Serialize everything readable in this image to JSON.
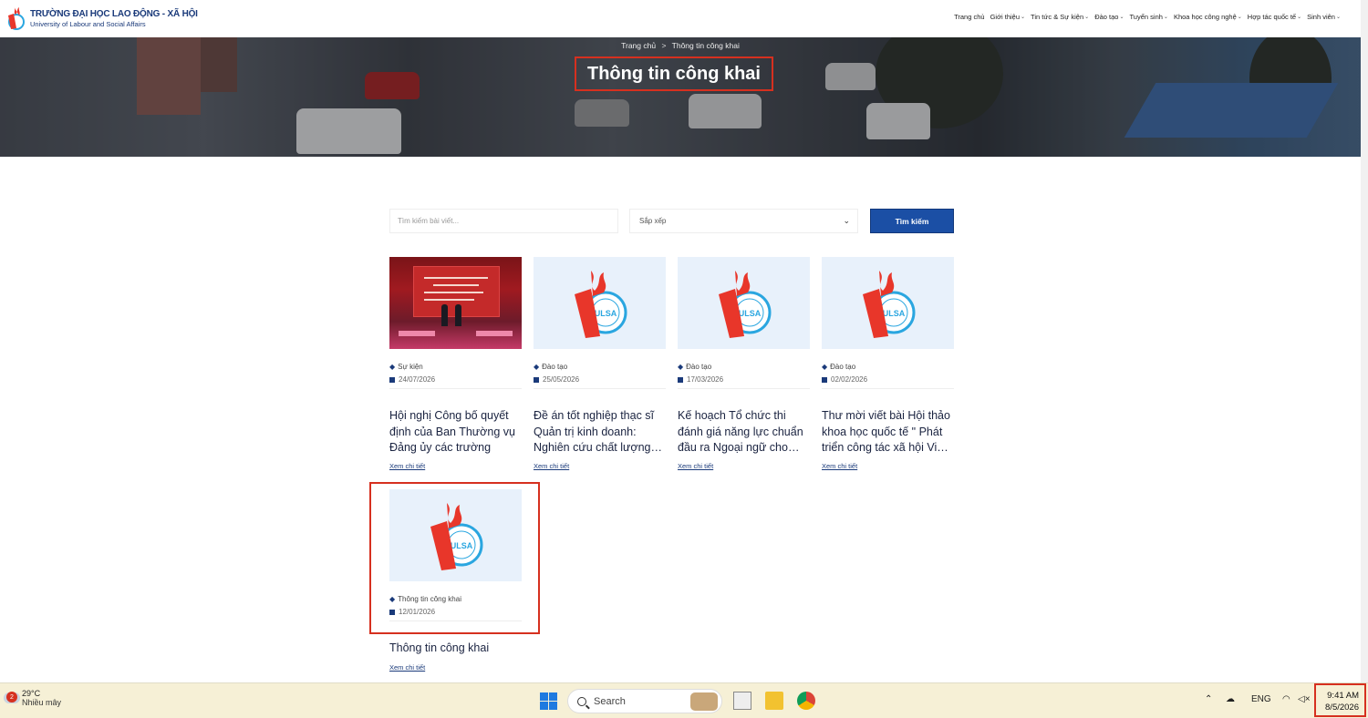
{
  "header": {
    "logo_title": "TRƯỜNG ĐẠI HỌC LAO ĐỘNG - XÃ HỘI",
    "logo_subtitle": "University of Labour and Social Affairs",
    "nav": [
      {
        "label": "Trang chủ",
        "dropdown": false
      },
      {
        "label": "Giới thiệu",
        "dropdown": true
      },
      {
        "label": "Tin tức & Sự kiện",
        "dropdown": true
      },
      {
        "label": "Đào tạo",
        "dropdown": true
      },
      {
        "label": "Tuyển sinh",
        "dropdown": true
      },
      {
        "label": "Khoa học công nghệ",
        "dropdown": true
      },
      {
        "label": "Hợp tác quốc tế",
        "dropdown": true
      },
      {
        "label": "Sinh viên",
        "dropdown": true
      }
    ]
  },
  "hero": {
    "breadcrumb_home": "Trang chủ",
    "breadcrumb_sep": ">",
    "breadcrumb_current": "Thông tin công khai",
    "title": "Thông tin công khai"
  },
  "search": {
    "placeholder": "Tìm kiếm bài viết...",
    "sort_label": "Sắp xếp",
    "button": "Tìm kiếm"
  },
  "posts": [
    {
      "category": "Sự kiện",
      "date": "24/07/2026",
      "title": "Hội nghị Công bố quyết định của Ban Thường vụ Đảng ủy các trường Đại…",
      "more": "Xem chi tiết",
      "image": "event-photo"
    },
    {
      "category": "Đào tạo",
      "date": "25/05/2026",
      "title": "Đề án tốt nghiệp thạc sĩ Quản trị kinh doanh: Nghiên cứu chất lượng…",
      "more": "Xem chi tiết",
      "image": "ulsa-logo"
    },
    {
      "category": "Đào tạo",
      "date": "17/03/2026",
      "title": "Kế hoạch Tổ chức thi đánh giá năng lực chuẩn đầu ra Ngoại ngữ cho…",
      "more": "Xem chi tiết",
      "image": "ulsa-logo"
    },
    {
      "category": "Đào tạo",
      "date": "02/02/2026",
      "title": "Thư mời viết bài Hội thảo khoa học quốc tế \" Phát triển công tác xã hội Vi…",
      "more": "Xem chi tiết",
      "image": "ulsa-logo"
    },
    {
      "category": "Thông tin công khai",
      "date": "12/01/2026",
      "title": "Thông tin công khai",
      "more": "Xem chi tiết",
      "image": "ulsa-logo"
    }
  ],
  "taskbar": {
    "weather_badge": "2",
    "weather_temp": "29°C",
    "weather_desc": "Nhiều mây",
    "search_label": "Search",
    "language": "ENG",
    "time": "9:41 AM",
    "date": "8/5/2026"
  },
  "colors": {
    "brand_blue": "#1b4fa5",
    "highlight_red": "#d6301f",
    "logo_red": "#e8362a",
    "logo_cyan": "#2aa6e0"
  }
}
